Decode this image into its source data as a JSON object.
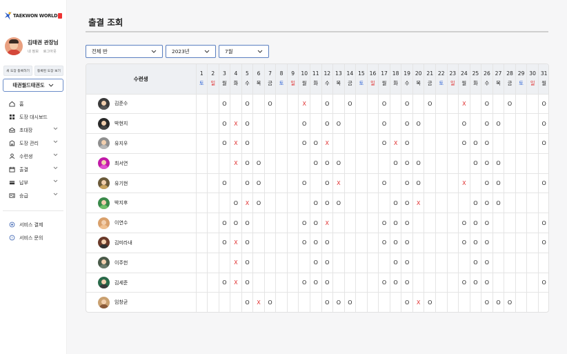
{
  "sidebar": {
    "logo_text": "TAEKWON WORLD",
    "profile": {
      "name": "김태권 관장님",
      "links": [
        "내 정보",
        "로그아웃"
      ]
    },
    "small_buttons": [
      "새 도장 등록하기",
      "등록된 도장 보기"
    ],
    "dojo_select": "태권월드태권도",
    "menu": [
      {
        "label": "홈",
        "icon": "home-icon",
        "chevron": false
      },
      {
        "label": "도장 대시보드",
        "icon": "grid-icon",
        "chevron": false
      },
      {
        "label": "초대장",
        "icon": "invite-icon",
        "chevron": true
      },
      {
        "label": "도장 관리",
        "icon": "building-icon",
        "chevron": true
      },
      {
        "label": "수련생",
        "icon": "user-icon",
        "chevron": true
      },
      {
        "label": "출결",
        "icon": "calendar-icon",
        "chevron": true
      },
      {
        "label": "납부",
        "icon": "card-icon",
        "chevron": true
      },
      {
        "label": "승급",
        "icon": "id-card-icon",
        "chevron": true
      }
    ],
    "menu2": [
      {
        "label": "서비스 결제",
        "icon": "payment-icon"
      },
      {
        "label": "서비스 문의",
        "icon": "help-icon"
      }
    ]
  },
  "main": {
    "title": "출결 조회",
    "filters": {
      "class": "전체 반",
      "year": "2023년",
      "month": "7월"
    },
    "table": {
      "first_header": "수련생",
      "days": [
        "1",
        "2",
        "3",
        "4",
        "5",
        "6",
        "7",
        "8",
        "9",
        "10",
        "11",
        "12",
        "13",
        "14",
        "15",
        "16",
        "17",
        "18",
        "19",
        "20",
        "21",
        "22",
        "23",
        "24",
        "25",
        "26",
        "27",
        "28",
        "29",
        "30",
        "31"
      ],
      "weekdays": [
        "토",
        "일",
        "월",
        "화",
        "수",
        "목",
        "금",
        "토",
        "일",
        "월",
        "화",
        "수",
        "목",
        "금",
        "토",
        "일",
        "월",
        "화",
        "수",
        "목",
        "금",
        "토",
        "일",
        "월",
        "화",
        "수",
        "목",
        "금",
        "토",
        "일",
        "월"
      ],
      "students": [
        {
          "name": "김준수",
          "marks": [
            "",
            "",
            "O",
            "",
            "O",
            "",
            "O",
            "",
            "",
            "X",
            "",
            "O",
            "",
            "O",
            "",
            "",
            "O",
            "",
            "O",
            "",
            "O",
            "",
            "",
            "X",
            "",
            "O",
            "",
            "O",
            "",
            "",
            "O"
          ]
        },
        {
          "name": "박현지",
          "marks": [
            "",
            "",
            "O",
            "X",
            "O",
            "",
            "",
            "",
            "",
            "O",
            "",
            "O",
            "O",
            "",
            "",
            "",
            "O",
            "",
            "O",
            "O",
            "",
            "",
            "",
            "O",
            "",
            "O",
            "O",
            "",
            "",
            "",
            "O"
          ]
        },
        {
          "name": "유지우",
          "marks": [
            "",
            "",
            "O",
            "X",
            "O",
            "",
            "",
            "",
            "",
            "O",
            "O",
            "X",
            "",
            "",
            "",
            "",
            "O",
            "X",
            "O",
            "",
            "",
            "",
            "",
            "O",
            "O",
            "O",
            "",
            "",
            "",
            "",
            "O"
          ]
        },
        {
          "name": "최서연",
          "marks": [
            "",
            "",
            "",
            "X",
            "O",
            "O",
            "",
            "",
            "",
            "",
            "O",
            "O",
            "O",
            "",
            "",
            "",
            "",
            "O",
            "O",
            "O",
            "",
            "",
            "",
            "",
            "O",
            "O",
            "O",
            "",
            "",
            "",
            ""
          ]
        },
        {
          "name": "유기현",
          "marks": [
            "",
            "",
            "O",
            "",
            "O",
            "O",
            "",
            "",
            "",
            "O",
            "",
            "O",
            "X",
            "",
            "",
            "",
            "O",
            "",
            "O",
            "O",
            "",
            "",
            "",
            "X",
            "",
            "O",
            "O",
            "",
            "",
            "",
            "O"
          ]
        },
        {
          "name": "박지후",
          "marks": [
            "",
            "",
            "",
            "O",
            "X",
            "O",
            "",
            "",
            "",
            "",
            "O",
            "O",
            "O",
            "",
            "",
            "",
            "",
            "O",
            "O",
            "X",
            "",
            "",
            "",
            "",
            "O",
            "O",
            "O",
            "",
            "",
            "",
            ""
          ]
        },
        {
          "name": "이연수",
          "marks": [
            "",
            "",
            "O",
            "O",
            "O",
            "",
            "",
            "",
            "",
            "O",
            "O",
            "X",
            "",
            "",
            "",
            "",
            "O",
            "O",
            "O",
            "",
            "",
            "",
            "",
            "O",
            "O",
            "O",
            "",
            "",
            "",
            "",
            "O"
          ]
        },
        {
          "name": "김미라내",
          "marks": [
            "",
            "",
            "O",
            "X",
            "O",
            "",
            "",
            "",
            "",
            "O",
            "O",
            "O",
            "",
            "",
            "",
            "",
            "O",
            "O",
            "O",
            "",
            "",
            "",
            "",
            "O",
            "O",
            "O",
            "",
            "",
            "",
            "",
            "O"
          ]
        },
        {
          "name": "이주헌",
          "marks": [
            "",
            "",
            "",
            "X",
            "O",
            "",
            "",
            "",
            "",
            "",
            "O",
            "O",
            "",
            "",
            "",
            "",
            "",
            "O",
            "O",
            "",
            "",
            "",
            "",
            "",
            "O",
            "O",
            "",
            "",
            "",
            "",
            ""
          ]
        },
        {
          "name": "김세준",
          "marks": [
            "",
            "",
            "O",
            "X",
            "O",
            "",
            "",
            "",
            "",
            "O",
            "O",
            "O",
            "",
            "",
            "",
            "",
            "O",
            "O",
            "O",
            "",
            "",
            "",
            "",
            "O",
            "O",
            "O",
            "",
            "",
            "",
            "",
            "O"
          ]
        },
        {
          "name": "임창균",
          "marks": [
            "",
            "",
            "",
            "",
            "O",
            "X",
            "O",
            "",
            "",
            "",
            "",
            "O",
            "O",
            "O",
            "",
            "",
            "",
            "",
            "O",
            "X",
            "O",
            "",
            "",
            "",
            "",
            "O",
            "O",
            "O",
            "",
            "",
            ""
          ]
        }
      ]
    }
  },
  "colors": {
    "accent": "#5a7fc0",
    "saturday": "#2f63d6",
    "sunday": "#e03030",
    "absent": "#e03030"
  }
}
